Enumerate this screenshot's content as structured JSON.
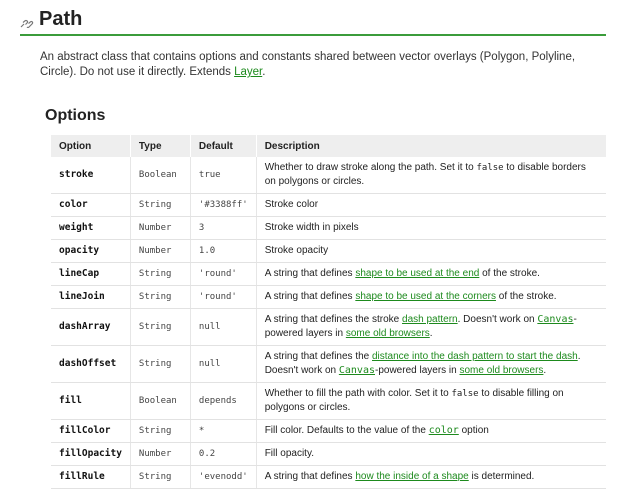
{
  "header": {
    "title": "Path",
    "anchor_icon": "link-icon"
  },
  "intro": {
    "text": "An abstract class that contains options and constants shared between vector overlays (Polygon, Polyline, Circle). Do not use it directly. Extends ",
    "link": "Layer",
    "suffix": "."
  },
  "options": {
    "heading": "Options",
    "columns": [
      "Option",
      "Type",
      "Default",
      "Description"
    ],
    "rows": [
      {
        "option": "stroke",
        "type": "Boolean",
        "default": "true",
        "desc": [
          [
            "t",
            "Whether to draw stroke along the path. Set it to "
          ],
          [
            "c",
            "false"
          ],
          [
            "t",
            " to disable borders on polygons or circles."
          ]
        ]
      },
      {
        "option": "color",
        "type": "String",
        "default": "'#3388ff'",
        "desc": [
          [
            "t",
            "Stroke color"
          ]
        ]
      },
      {
        "option": "weight",
        "type": "Number",
        "default": "3",
        "desc": [
          [
            "t",
            "Stroke width in pixels"
          ]
        ]
      },
      {
        "option": "opacity",
        "type": "Number",
        "default": "1.0",
        "desc": [
          [
            "t",
            "Stroke opacity"
          ]
        ]
      },
      {
        "option": "lineCap",
        "type": "String",
        "default": "'round'",
        "desc": [
          [
            "t",
            "A string that defines "
          ],
          [
            "l",
            "shape to be used at the end"
          ],
          [
            "t",
            " of the stroke."
          ]
        ]
      },
      {
        "option": "lineJoin",
        "type": "String",
        "default": "'round'",
        "desc": [
          [
            "t",
            "A string that defines "
          ],
          [
            "l",
            "shape to be used at the corners"
          ],
          [
            "t",
            " of the stroke."
          ]
        ]
      },
      {
        "option": "dashArray",
        "type": "String",
        "default": "null",
        "desc": [
          [
            "t",
            "A string that defines the stroke "
          ],
          [
            "l",
            "dash pattern"
          ],
          [
            "t",
            ". Doesn't work on "
          ],
          [
            "cl",
            "Canvas"
          ],
          [
            "t",
            "-powered layers in "
          ],
          [
            "l",
            "some old browsers"
          ],
          [
            "t",
            "."
          ]
        ]
      },
      {
        "option": "dashOffset",
        "type": "String",
        "default": "null",
        "desc": [
          [
            "t",
            "A string that defines the "
          ],
          [
            "l",
            "distance into the dash pattern to start the dash"
          ],
          [
            "t",
            ". Doesn't work on "
          ],
          [
            "cl",
            "Canvas"
          ],
          [
            "t",
            "-powered layers in "
          ],
          [
            "l",
            "some old browsers"
          ],
          [
            "t",
            "."
          ]
        ]
      },
      {
        "option": "fill",
        "type": "Boolean",
        "default": "depends",
        "desc": [
          [
            "t",
            "Whether to fill the path with color. Set it to "
          ],
          [
            "c",
            "false"
          ],
          [
            "t",
            " to disable filling on polygons or circles."
          ]
        ]
      },
      {
        "option": "fillColor",
        "type": "String",
        "default": "*",
        "desc": [
          [
            "t",
            "Fill color. Defaults to the value of the "
          ],
          [
            "cl",
            "color"
          ],
          [
            "t",
            " option"
          ]
        ]
      },
      {
        "option": "fillOpacity",
        "type": "Number",
        "default": "0.2",
        "desc": [
          [
            "t",
            "Fill opacity."
          ]
        ]
      },
      {
        "option": "fillRule",
        "type": "String",
        "default": "'evenodd'",
        "desc": [
          [
            "t",
            "A string that defines "
          ],
          [
            "l",
            "how the inside of a shape"
          ],
          [
            "t",
            " is determined."
          ]
        ]
      }
    ]
  },
  "colors": {
    "accent": "#3b9c3b",
    "link": "#1d8a1d",
    "header_bg": "#eeeeee"
  }
}
